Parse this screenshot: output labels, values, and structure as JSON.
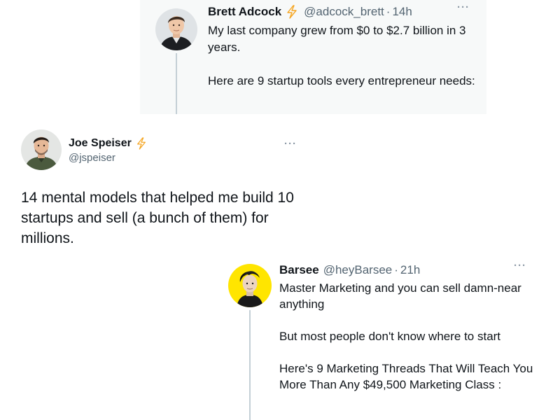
{
  "tweets": [
    {
      "name": "Brett Adcock",
      "handle": "@adcock_brett",
      "separator": "·",
      "time": "14h",
      "more": "···",
      "text": [
        "My last company grew from $0 to $2.7 billion in 3 years.",
        "Here are 9 startup tools every entrepreneur needs:"
      ],
      "avatar_icon": "profile-photo",
      "verified_icon": "lightning-bolt-icon"
    },
    {
      "name": "Joe Speiser",
      "handle": "@jspeiser",
      "more": "···",
      "text": "14 mental models that helped me build 10 startups and sell (a bunch of them) for millions.",
      "avatar_icon": "profile-photo",
      "verified_icon": "lightning-bolt-icon"
    },
    {
      "name": "Barsee",
      "handle": "@heyBarsee",
      "separator": "·",
      "time": "21h",
      "more": "···",
      "text": [
        "Master Marketing and you can sell damn-near anything",
        "But most people don't know where to start",
        "Here's 9 Marketing Threads That Will Teach You More Than Any $49,500 Marketing Class :"
      ],
      "avatar_icon": "profile-photo"
    }
  ],
  "colors": {
    "text_primary": "#0f1419",
    "text_secondary": "#536471",
    "thread_line": "#c4cfd6",
    "tweet1_background": "#f7f9f9",
    "bolt": "#f5a623",
    "barsee_avatar_ring": "#ffe500"
  }
}
